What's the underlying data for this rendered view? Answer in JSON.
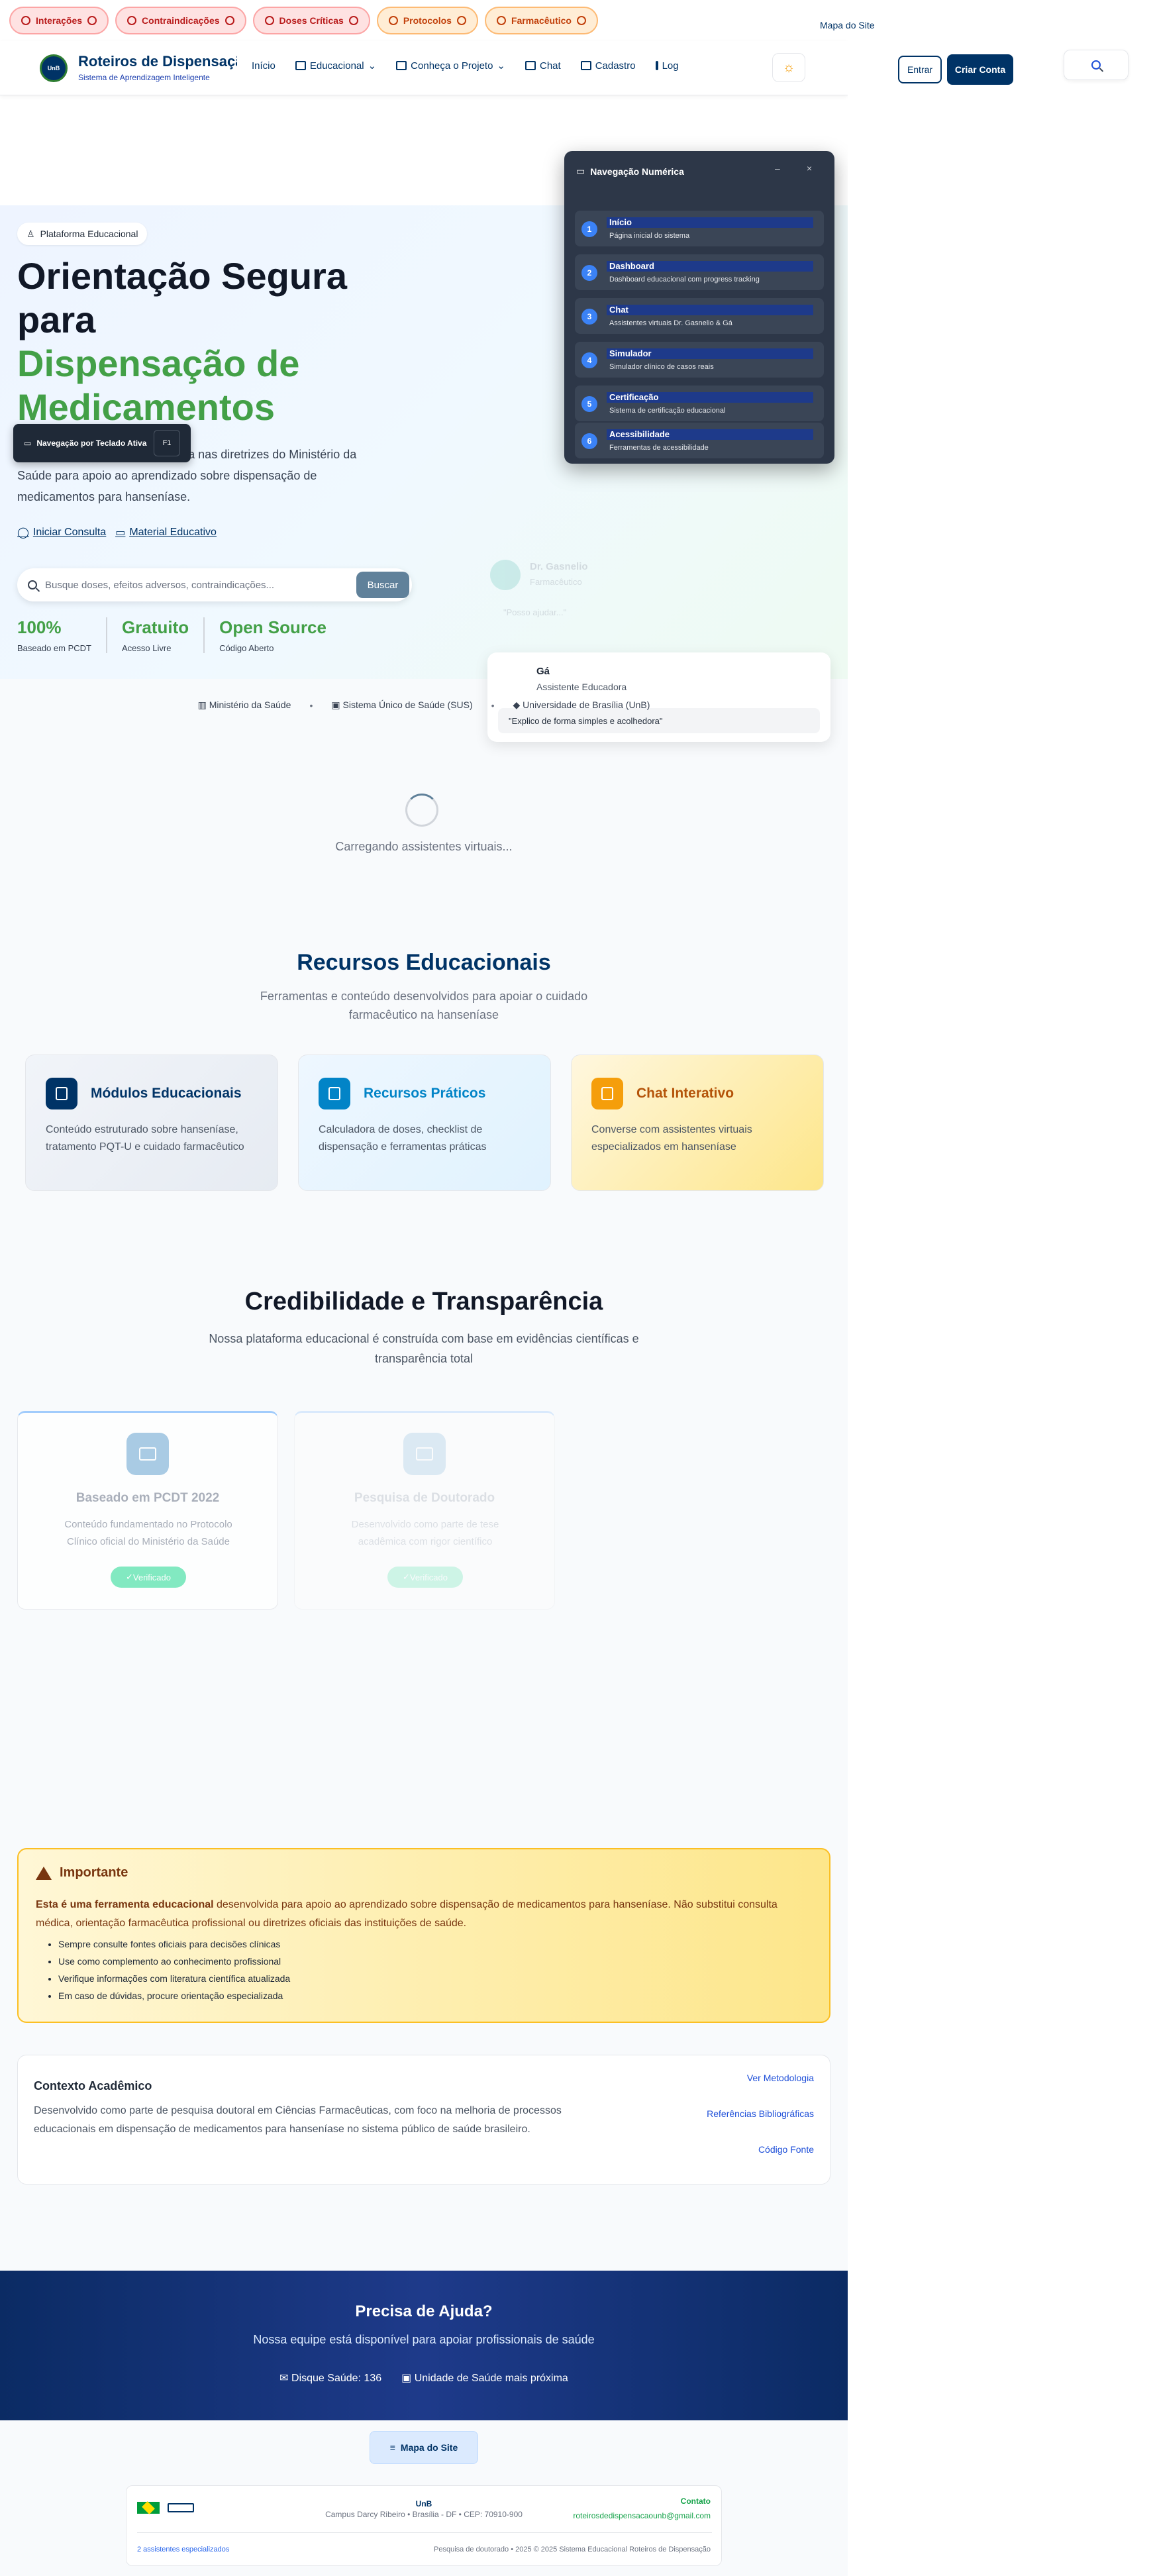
{
  "quick_access": [
    {
      "label": "Interações",
      "tone": "red"
    },
    {
      "label": "Contraindicações",
      "tone": "red"
    },
    {
      "label": "Doses Críticas",
      "tone": "red"
    },
    {
      "label": "Protocolos",
      "tone": "orange"
    },
    {
      "label": "Farmacêutico",
      "tone": "orange"
    }
  ],
  "header": {
    "logo_text": "UnB",
    "title": "Roteiros de Dispensação",
    "subtitle": "Sistema de Aprendizagem Inteligente",
    "nav": [
      "Início",
      "Educacional",
      "Conheça o Projeto",
      "Chat",
      "Cadastro",
      "Login"
    ],
    "sitemap_label": "Mapa do Site",
    "login_label": "Entrar",
    "signup_label": "Criar Conta"
  },
  "hero": {
    "badge": "Plataforma Educacional",
    "title_line1": "Orientação Segura",
    "title_line2": "para",
    "title_green1": "Dispensação de",
    "title_green2": "Medicamentos",
    "description": "Ferramenta educacional baseada nas diretrizes do Ministério da Saúde para apoio ao aprendizado sobre dispensação de medicamentos para hanseníase.",
    "link_consult": "Iniciar Consulta",
    "link_material": "Material Educativo",
    "search_placeholder": "Busque doses, efeitos adversos, contraindicações...",
    "search_button": "Buscar",
    "stats": [
      {
        "value": "100%",
        "label": "Baseado em PCDT"
      },
      {
        "value": "Gratuito",
        "label": "Acesso Livre"
      },
      {
        "value": "Open Source",
        "label": "Código Aberto"
      }
    ],
    "keyboard_tip": "Navegação por Teclado Ativa",
    "keyboard_key": "F1",
    "ghost_assistant": {
      "name": "Dr. Gasnelio",
      "role": "Farmacêutico",
      "quote": "\"Posso ajudar...\""
    },
    "assistant": {
      "name": "Gá",
      "role": "Assistente Educadora",
      "quote": "\"Explico de forma simples e acolhedora\""
    }
  },
  "numeric_nav": {
    "title": "Navegação Numérica",
    "minimize": "–",
    "close": "×",
    "items": [
      {
        "num": "1",
        "title": "Início",
        "desc": "Página inicial do sistema"
      },
      {
        "num": "2",
        "title": "Dashboard",
        "desc": "Dashboard educacional com progress tracking"
      },
      {
        "num": "3",
        "title": "Chat",
        "desc": "Assistentes virtuais Dr. Gasnelio & Gá"
      },
      {
        "num": "4",
        "title": "Simulador",
        "desc": "Simulador clínico de casos reais"
      },
      {
        "num": "5",
        "title": "Certificação",
        "desc": "Sistema de certificação educacional"
      },
      {
        "num": "6",
        "title": "Acessibilidade",
        "desc": "Ferramentas de acessibilidade"
      }
    ]
  },
  "institutions": [
    "Ministério da Saúde",
    "Sistema Único de Saúde (SUS)",
    "Universidade de Brasília (UnB)"
  ],
  "loading_text": "Carregando assistentes virtuais...",
  "resources": {
    "title": "Recursos Educacionais",
    "description": "Ferramentas e conteúdo desenvolvidos para apoiar o cuidado farmacêutico na hanseníase",
    "cards": [
      {
        "title": "Módulos Educacionais",
        "desc": "Conteúdo estruturado sobre hanseníase, tratamento PQT-U e cuidado farmacêutico",
        "accent": "#003366",
        "bg": "#e8ecf3"
      },
      {
        "title": "Recursos Práticos",
        "desc": "Calculadora de doses, checklist de dispensação e ferramentas práticas",
        "accent": "#0284c7",
        "bg": "#e0f2fe"
      },
      {
        "title": "Chat Interativo",
        "desc": "Converse com assistentes virtuais especializados em hanseníase",
        "accent": "#f59e0b",
        "bg": "#fef3c7"
      }
    ]
  },
  "credibility": {
    "title": "Credibilidade e Transparência",
    "description": "Nossa plataforma educacional é construída com base em evidências científicas e transparência total",
    "cards": [
      {
        "title": "Baseado em PCDT 2022",
        "desc": "Conteúdo fundamentado no Protocolo Clínico oficial do Ministério da Saúde",
        "badge": "Verificado"
      },
      {
        "title": "Pesquisa de Doutorado",
        "desc": "Desenvolvido como parte de tese acadêmica com rigor científico",
        "badge": "Verificado"
      }
    ]
  },
  "important": {
    "title": "Importante",
    "lead": "Esta é uma ferramenta educacional",
    "text": " desenvolvida para apoio ao aprendizado sobre dispensação de medicamentos para hanseníase. Não substitui consulta médica, orientação farmacêutica profissional ou diretrizes oficiais das instituições de saúde.",
    "bullets": [
      "Sempre consulte fontes oficiais para decisões clínicas",
      "Use como complemento ao conhecimento profissional",
      "Verifique informações com literatura científica atualizada",
      "Em caso de dúvidas, procure orientação especializada"
    ]
  },
  "academic": {
    "title": "Contexto Acadêmico",
    "text": "Desenvolvido como parte de pesquisa doutoral em Ciências Farmacêuticas, com foco na melhoria de processos educacionais em dispensação de medicamentos para hanseníase no sistema público de saúde brasileiro.",
    "links": [
      "Ver Metodologia",
      "Referências Bibliográficas",
      "Código Fonte"
    ]
  },
  "help": {
    "title": "Precisa de Ajuda?",
    "description": "Nossa equipe está disponível para apoiar profissionais de saúde",
    "phone": "Disque Saúde: 136",
    "unit": "Unidade de Saúde mais próxima"
  },
  "sitemap_button": "Mapa do Site",
  "footer": {
    "center_title": "UnB",
    "address": "Campus Darcy Ribeiro • Brasília - DF • CEP: 70910-900",
    "contact_title": "Contato",
    "email": "roteirosdedispensacaounb@gmail.com",
    "assistants": "2 assistentes especializados",
    "copyright": "Pesquisa de doutorado • 2025 © 2025 Sistema Educacional Roteiros de Dispensação"
  },
  "colors": {
    "primary": "#003366",
    "green": "#43a047",
    "danger": "#b91c1c",
    "warning": "#c2410c"
  }
}
